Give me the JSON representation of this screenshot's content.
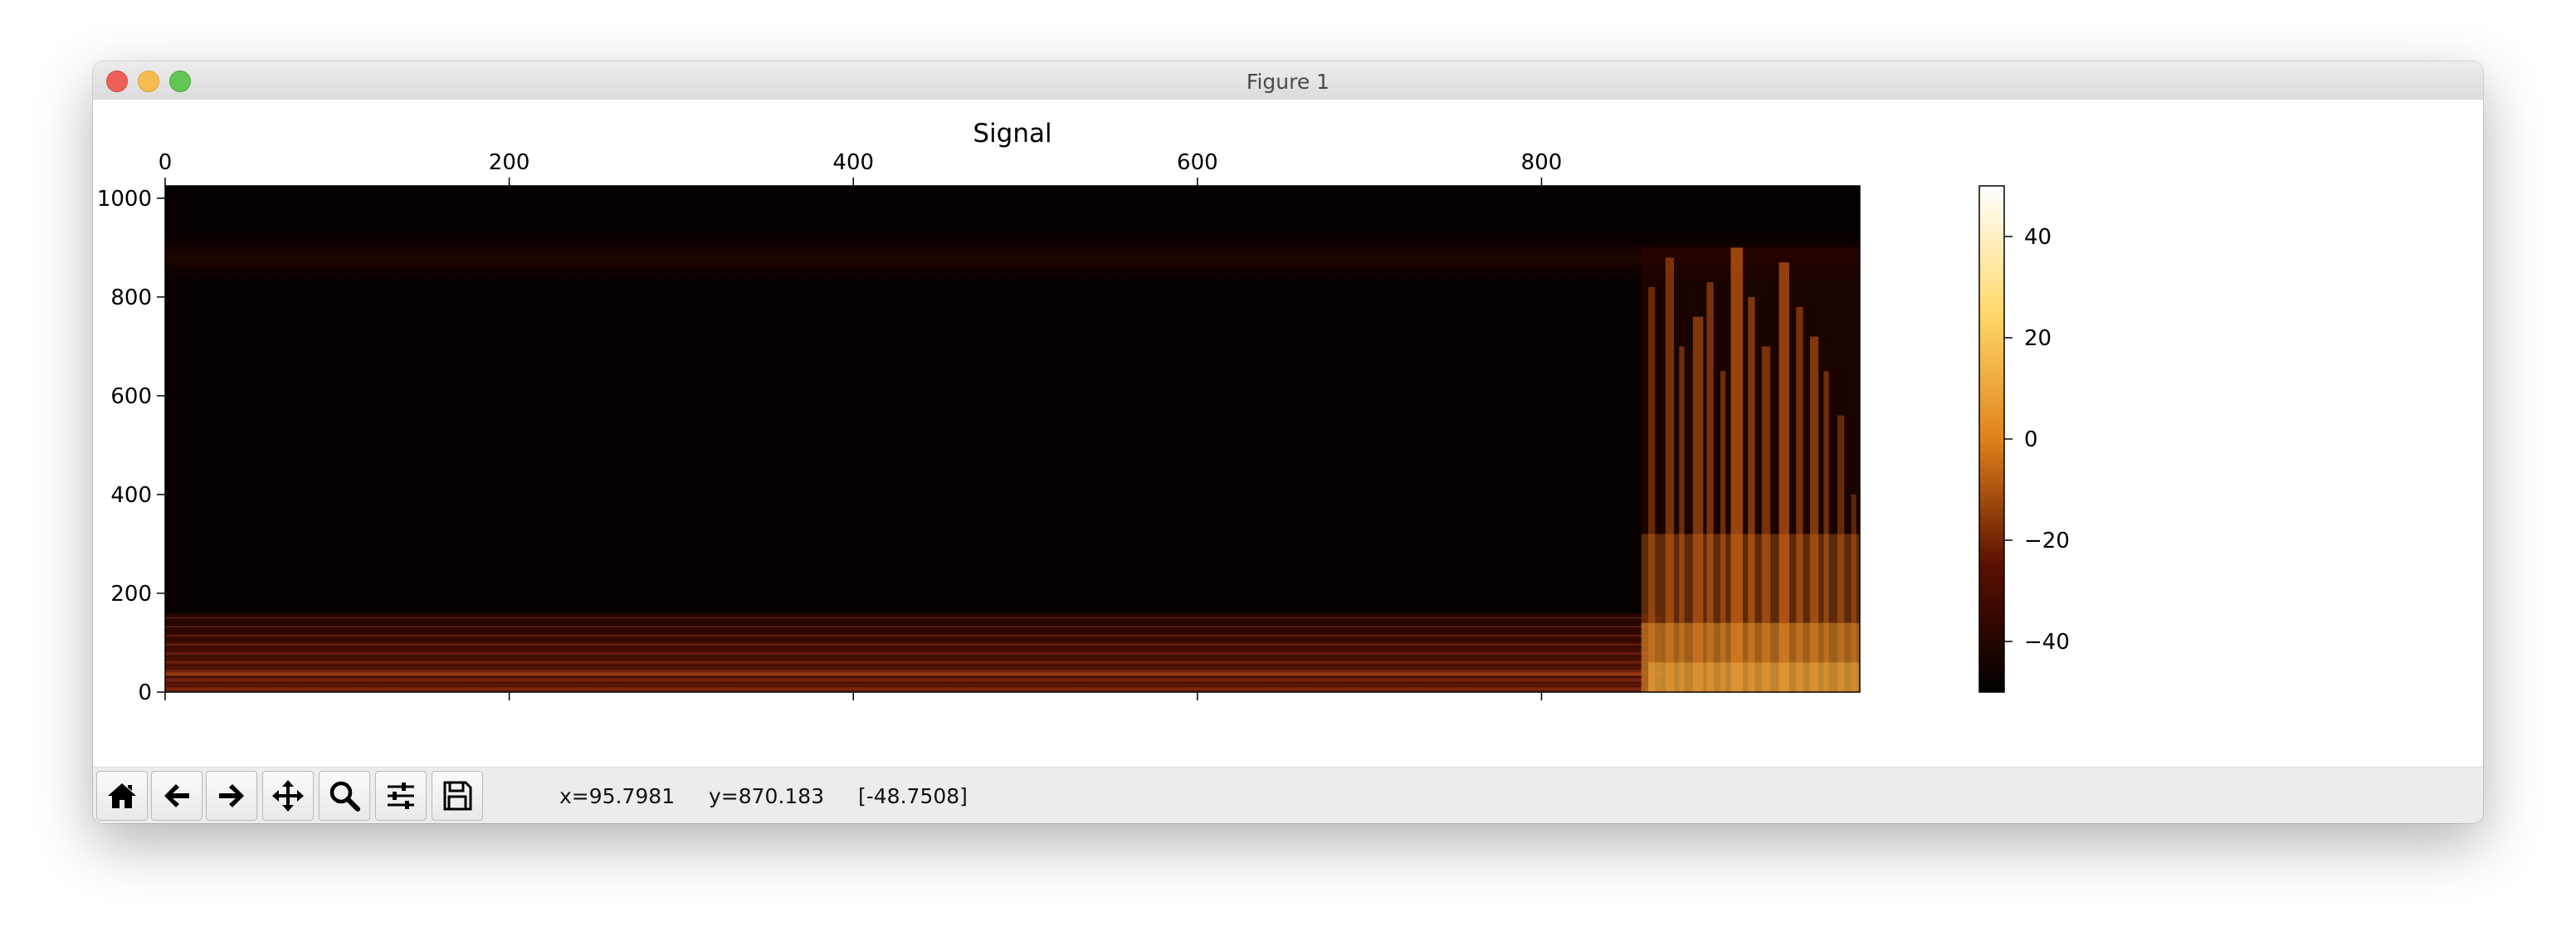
{
  "window": {
    "title": "Figure 1"
  },
  "toolbar": {
    "buttons": [
      {
        "name": "home-button",
        "icon": "home-icon"
      },
      {
        "name": "back-button",
        "icon": "arrow-left-icon"
      },
      {
        "name": "forward-button",
        "icon": "arrow-right-icon"
      },
      {
        "name": "pan-button",
        "icon": "move-icon"
      },
      {
        "name": "zoom-button",
        "icon": "magnifier-icon"
      },
      {
        "name": "configure-subplots-button",
        "icon": "sliders-icon"
      },
      {
        "name": "save-button",
        "icon": "floppy-disk-icon"
      }
    ],
    "status": {
      "x": "x=95.7981",
      "y": "y=870.183",
      "value": "[-48.7508]"
    }
  },
  "chart_data": {
    "type": "heatmap",
    "title": "Signal",
    "xlabel": "",
    "ylabel": "",
    "x_ticks": [
      "0",
      "200",
      "400",
      "600",
      "800"
    ],
    "x_tick_values": [
      0,
      200,
      400,
      600,
      800
    ],
    "y_ticks": [
      "0",
      "200",
      "400",
      "600",
      "800",
      "1000"
    ],
    "y_tick_values": [
      0,
      200,
      400,
      600,
      800,
      1000
    ],
    "xlim": [
      0,
      985
    ],
    "ylim": [
      0,
      1025
    ],
    "x_axis_position": "top",
    "colormap": "afmhot",
    "colorbar": {
      "ticks": [
        "40",
        "20",
        "0",
        "−20",
        "−40"
      ],
      "tick_values": [
        40,
        20,
        0,
        -20,
        -40
      ],
      "range": [
        -50,
        50
      ]
    },
    "features": [
      {
        "region": "low-frequency band",
        "x": [
          0,
          860
        ],
        "y": [
          0,
          150
        ],
        "level": -38
      },
      {
        "region": "speech burst",
        "x": [
          860,
          985
        ],
        "y": [
          0,
          900
        ],
        "level": 10
      }
    ]
  }
}
